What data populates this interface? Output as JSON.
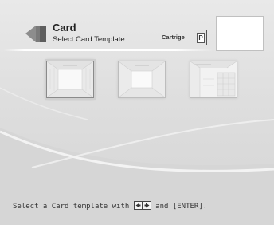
{
  "header": {
    "title": "Card",
    "subtitle": "Select Card Template",
    "icon": "card-icon"
  },
  "cartridge": {
    "label": "Cartrige",
    "slot_letter": "P",
    "icon": "cartridge-icon"
  },
  "templates": [
    {
      "name": "template-1",
      "selected": true
    },
    {
      "name": "template-2",
      "selected": false
    },
    {
      "name": "template-3",
      "selected": false
    }
  ],
  "footer": {
    "text_before": "Select a Card template with",
    "text_after": "and [ENTER].",
    "key_icons": [
      "left-arrow-key-icon",
      "right-arrow-key-icon"
    ]
  },
  "colors": {
    "background": "#dedede",
    "text": "#222222",
    "header_rule": "#ffffff"
  }
}
